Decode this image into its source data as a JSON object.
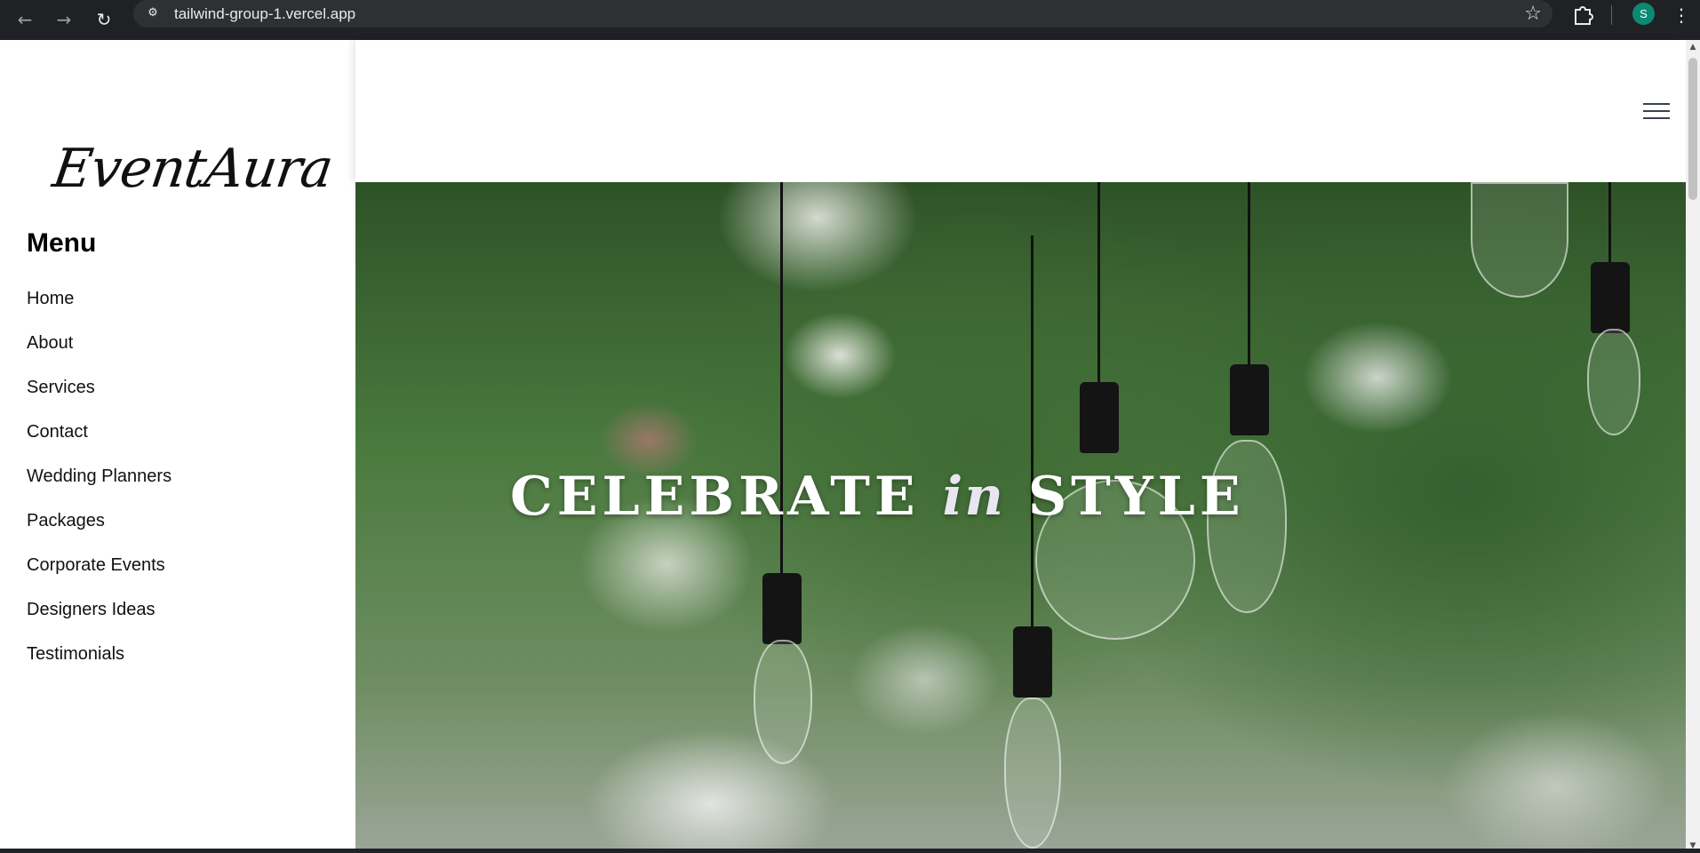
{
  "browser": {
    "url": "tailwind-group-1.vercel.app",
    "back_icon": "arrow-left-icon",
    "forward_icon": "arrow-right-icon",
    "reload_icon": "reload-icon",
    "site_info_icon": "site-info-icon",
    "bookmark_icon": "star-icon",
    "extensions_icon": "puzzle-icon",
    "profile_initial": "S",
    "profile_color": "#0b8a73",
    "menu_icon": "vertical-dots-icon"
  },
  "sidebar": {
    "logo": "EventAura",
    "menu_title": "Menu",
    "items": [
      {
        "label": "Home"
      },
      {
        "label": "About"
      },
      {
        "label": "Services"
      },
      {
        "label": "Contact"
      },
      {
        "label": "Wedding Planners"
      },
      {
        "label": "Packages"
      },
      {
        "label": "Corporate Events"
      },
      {
        "label": "Designers Ideas"
      },
      {
        "label": "Testimonials"
      }
    ]
  },
  "header": {
    "menu_icon": "hamburger-icon"
  },
  "hero": {
    "title_part1": "CELEBRATE",
    "title_part2": "in",
    "title_part3": "STYLE"
  }
}
